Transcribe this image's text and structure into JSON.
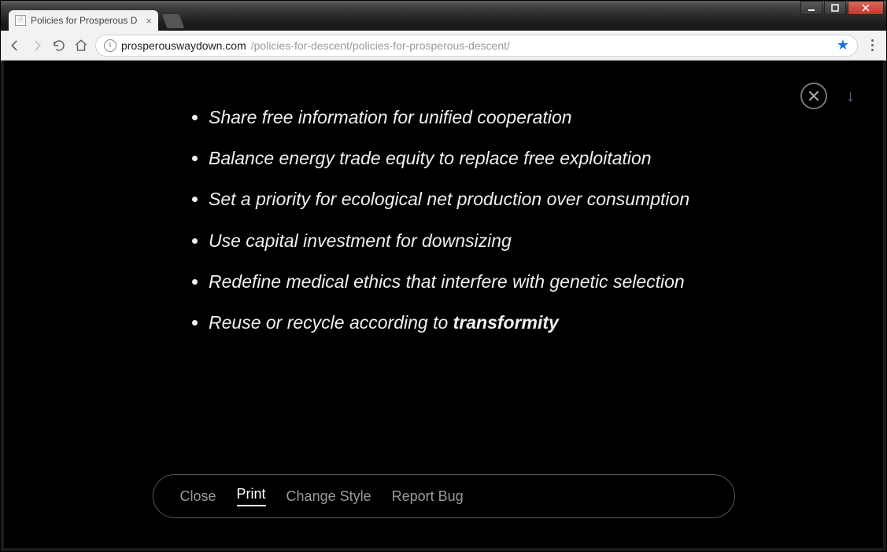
{
  "window": {
    "tab_title": "Policies for Prosperous D"
  },
  "toolbar": {
    "url_origin": "prosperouswaydown.com",
    "url_rest": "/policies-for-descent/policies-for-prosperous-descent/"
  },
  "reader": {
    "items": [
      "Share free information for unified cooperation",
      "Balance energy trade equity to replace free exploitation",
      "Set a priority for ecological net production over consumption",
      "Use capital investment for downsizing",
      "Redefine medical ethics that interfere with genetic selection"
    ],
    "last_item_prefix": "Reuse or recycle according to ",
    "last_item_bold": "transformity"
  },
  "bottom": {
    "close": "Close",
    "print": "Print",
    "change_style": "Change Style",
    "report_bug": "Report Bug"
  }
}
